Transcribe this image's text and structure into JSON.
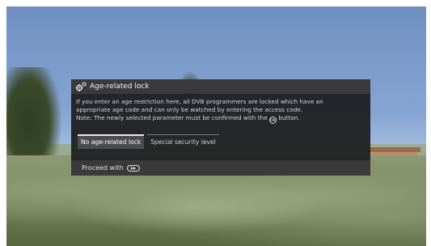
{
  "background": {
    "icon": "outdoor-landscape-image"
  },
  "dialog": {
    "title": "Age-related lock",
    "title_icon": "gear-icon",
    "body_lines": [
      "If you enter an age restriction here, all DVB programmers are locked which have an",
      "appropriate age code and can only be watched by entering the access code.",
      "Note: The newly selected parameter must be confirmed with the",
      "button."
    ],
    "ok_icon_label": "OK",
    "options": [
      {
        "label": "No age-related lock",
        "selected": true
      },
      {
        "label": "Special security level",
        "selected": false
      }
    ],
    "footer": {
      "label": "Proceed with",
      "icon": "fast-forward-icon"
    }
  },
  "colors": {
    "dialog_bg": "#202022",
    "header_bg": "#3a3a3c",
    "selected_option_bg": "#4c4c50"
  }
}
